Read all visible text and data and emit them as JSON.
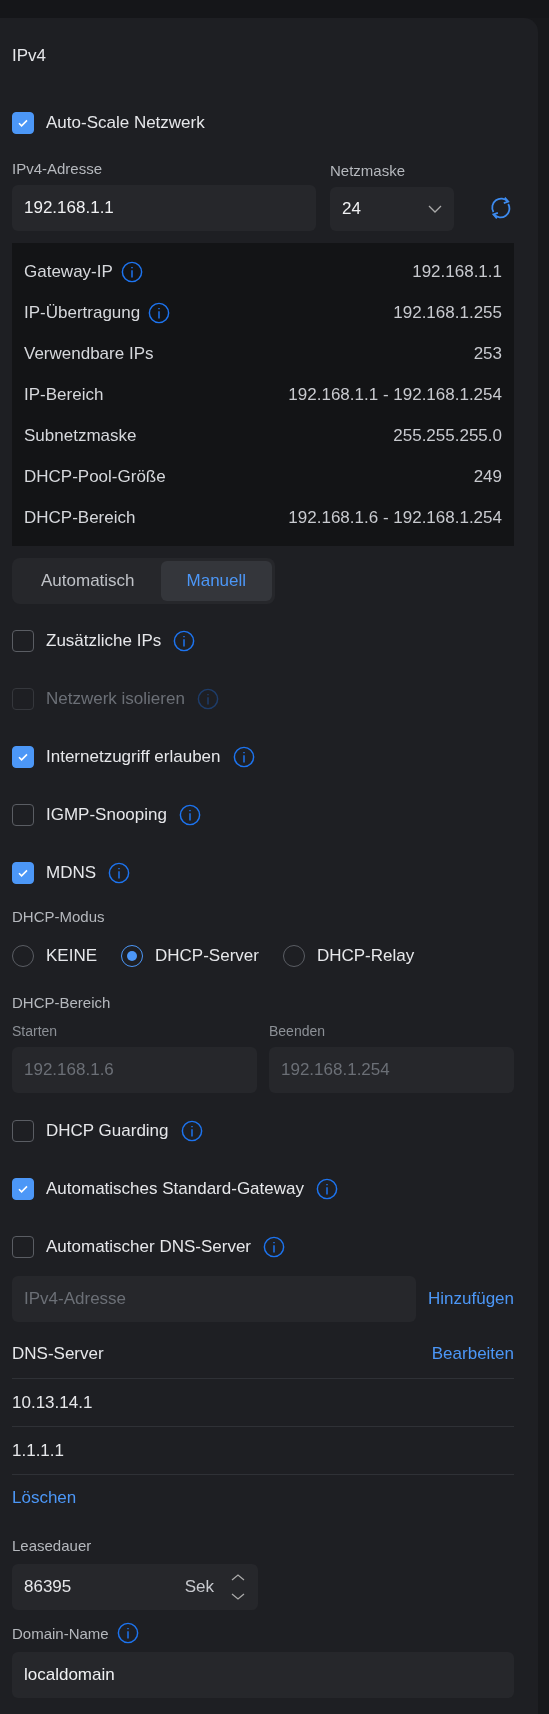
{
  "section_title": "IPv4",
  "auto_scale": {
    "label": "Auto-Scale Netzwerk",
    "checked": true
  },
  "address": {
    "label": "IPv4-Adresse",
    "value": "192.168.1.1"
  },
  "netmask": {
    "label": "Netzmaske",
    "value": "24"
  },
  "info_table": [
    {
      "label": "Gateway-IP",
      "value": "192.168.1.1",
      "info": true
    },
    {
      "label": "IP-Übertragung",
      "value": "192.168.1.255",
      "info": true
    },
    {
      "label": "Verwendbare IPs",
      "value": "253",
      "info": false
    },
    {
      "label": "IP-Bereich",
      "value": "192.168.1.1 - 192.168.1.254",
      "info": false
    },
    {
      "label": "Subnetzmaske",
      "value": "255.255.255.0",
      "info": false
    },
    {
      "label": "DHCP-Pool-Größe",
      "value": "249",
      "info": false
    },
    {
      "label": "DHCP-Bereich",
      "value": "192.168.1.6 - 192.168.1.254",
      "info": false
    }
  ],
  "mode_tabs": [
    {
      "label": "Automatisch",
      "selected": false
    },
    {
      "label": "Manuell",
      "selected": true
    }
  ],
  "options": [
    {
      "label": "Zusätzliche IPs",
      "checked": false,
      "disabled": false,
      "info": true
    },
    {
      "label": "Netzwerk isolieren",
      "checked": false,
      "disabled": true,
      "info": true
    },
    {
      "label": "Internetzugriff erlauben",
      "checked": true,
      "disabled": false,
      "info": true
    },
    {
      "label": "IGMP-Snooping",
      "checked": false,
      "disabled": false,
      "info": true
    },
    {
      "label": "MDNS",
      "checked": true,
      "disabled": false,
      "info": true
    }
  ],
  "dhcp_mode": {
    "label": "DHCP-Modus",
    "choices": [
      {
        "label": "KEINE",
        "selected": false
      },
      {
        "label": "DHCP-Server",
        "selected": true
      },
      {
        "label": "DHCP-Relay",
        "selected": false
      }
    ]
  },
  "dhcp_range": {
    "label": "DHCP-Bereich",
    "fields": [
      {
        "label": "Starten",
        "placeholder": "192.168.1.6"
      },
      {
        "label": "Beenden",
        "placeholder": "192.168.1.254"
      }
    ]
  },
  "dhcp_options": [
    {
      "label": "DHCP Guarding",
      "checked": false,
      "disabled": false,
      "info": true
    },
    {
      "label": "Automatisches Standard-Gateway",
      "checked": true,
      "disabled": false,
      "info": true
    },
    {
      "label": "Automatischer DNS-Server",
      "checked": false,
      "disabled": false,
      "info": true
    }
  ],
  "dns_add": {
    "placeholder": "IPv4-Adresse",
    "button": "Hinzufügen"
  },
  "dns_servers": {
    "title": "DNS-Server",
    "edit": "Bearbeiten",
    "items": [
      "10.13.14.1",
      "1.1.1.1"
    ],
    "delete": "Löschen"
  },
  "lease": {
    "label": "Leasedauer",
    "value": "86395",
    "unit": "Sek"
  },
  "domain": {
    "label": "Domain-Name",
    "info": true,
    "value": "localdomain"
  }
}
